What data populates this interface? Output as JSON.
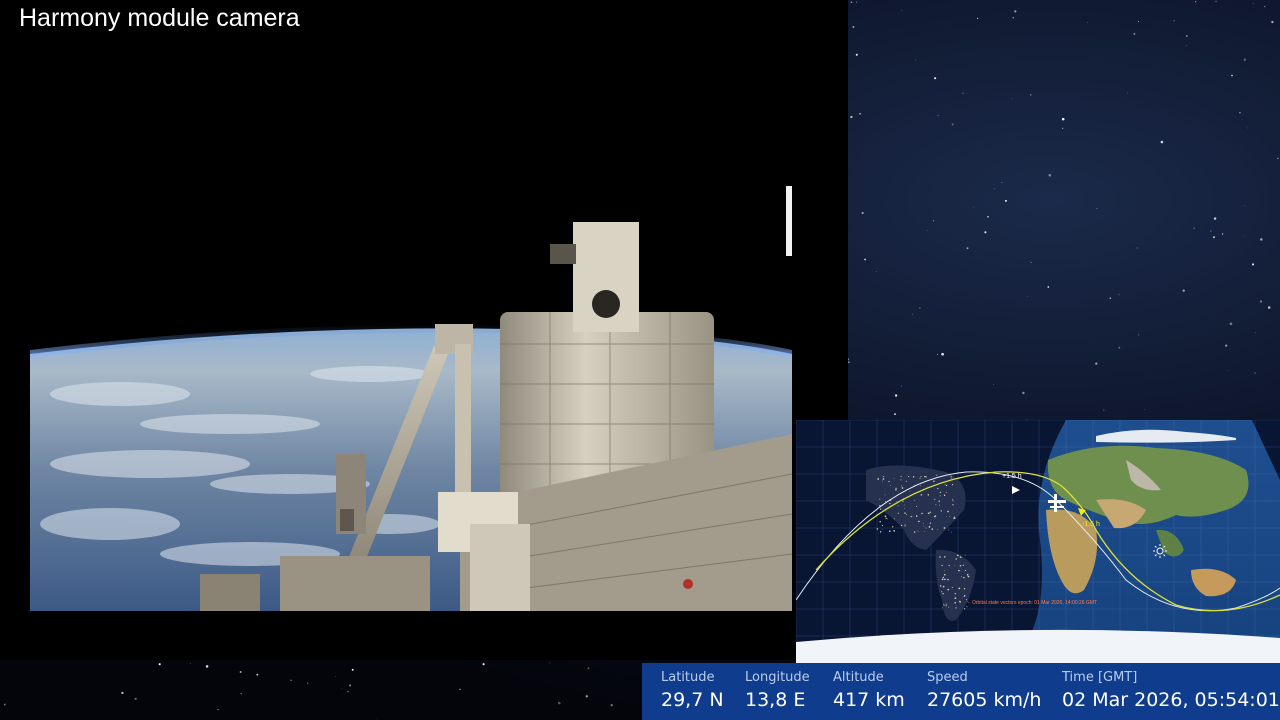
{
  "camera": {
    "title": "Harmony module camera"
  },
  "map": {
    "caption": "Orbital state vectors epoch: 01 Mar 2026, 14:00:26 GMT",
    "orbit_labels": {
      "forward": "+1.5 h",
      "backward": "-1.5 h"
    },
    "icons": [
      "sun-icon",
      "iss-icon",
      "direction-arrow-icon"
    ]
  },
  "telemetry": {
    "latitude": {
      "label": "Latitude",
      "value": "29,7 N"
    },
    "longitude": {
      "label": "Longitude",
      "value": "13,8 E"
    },
    "altitude": {
      "label": "Altitude",
      "value": "417 km"
    },
    "speed": {
      "label": "Speed",
      "value": "27605 km/h"
    },
    "time": {
      "label": "Time [GMT]",
      "value": "02 Mar 2026, 05:54:01"
    }
  },
  "colors": {
    "telemetry_bg": "#0f3c8c",
    "orbit_current": "#d8df3a",
    "orbit_other": "#e6ecf2"
  }
}
